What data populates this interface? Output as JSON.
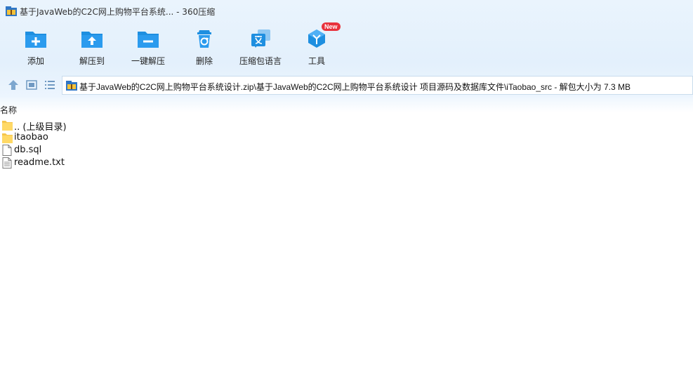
{
  "window": {
    "title": "基于JavaWeb的C2C网上购物平台系统... - 360压缩",
    "app_icon": "archive-icon"
  },
  "toolbar": {
    "buttons": [
      {
        "label": "添加",
        "icon": "folder-plus-icon"
      },
      {
        "label": "解压到",
        "icon": "folder-extract-icon"
      },
      {
        "label": "一键解压",
        "icon": "folder-minus-icon"
      },
      {
        "label": "删除",
        "icon": "recycle-bin-icon"
      },
      {
        "label": "压缩包语言",
        "icon": "language-icon"
      },
      {
        "label": "工具",
        "icon": "tools-cube-icon",
        "badge": "New"
      }
    ]
  },
  "nav": {
    "address": "基于JavaWeb的C2C网上购物平台系统设计.zip\\基于JavaWeb的C2C网上购物平台系统设计 项目源码及数据库文件\\iTaobao_src - 解包大小为 7.3 MB"
  },
  "list": {
    "column_name": "名称",
    "items": [
      {
        "name": ".. (上级目录)",
        "type": "folder"
      },
      {
        "name": "itaobao",
        "type": "folder"
      },
      {
        "name": "db.sql",
        "type": "file"
      },
      {
        "name": "readme.txt",
        "type": "text"
      }
    ]
  },
  "colors": {
    "accent": "#1e8fe0",
    "chrome_bg": "#e6f2fd",
    "badge": "#e8323c"
  }
}
